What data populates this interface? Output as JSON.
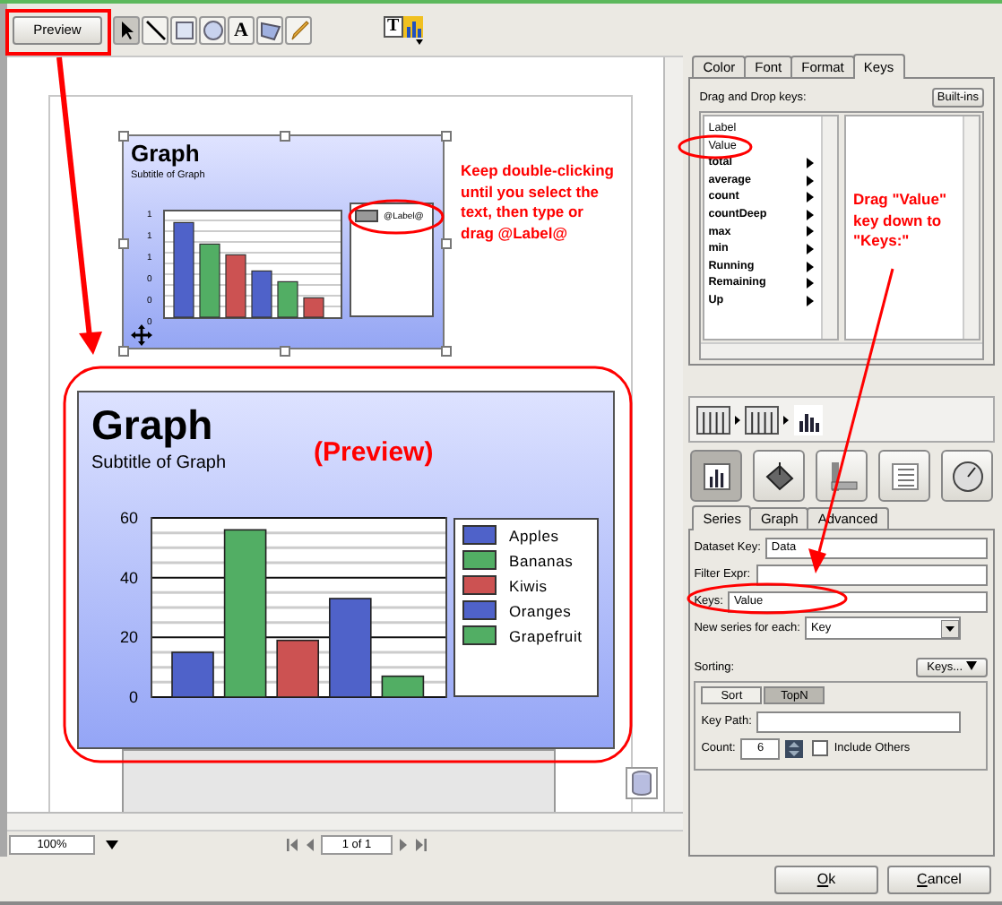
{
  "toolbar": {
    "preview_button": "Preview",
    "text_tool_glyph": "A",
    "chart_text_glyph": "T"
  },
  "designer_chart": {
    "title": "Graph",
    "subtitle": "Subtitle of Graph",
    "y_labels": [
      "1",
      "1",
      "1",
      "0",
      "0",
      "0"
    ],
    "legend_label": "@Label@"
  },
  "preview_chart": {
    "title": "Graph",
    "subtitle": "Subtitle of Graph",
    "chart_data": {
      "type": "bar",
      "ylim": [
        0,
        60
      ],
      "yticks": [
        0,
        20,
        40,
        60
      ],
      "series": [
        {
          "name": "Apples",
          "color": "#4f62c9",
          "values": [
            15
          ]
        },
        {
          "name": "Bananas",
          "color": "#52ae64",
          "values": [
            56
          ]
        },
        {
          "name": "Kiwis",
          "color": "#cc5252",
          "values": [
            19
          ]
        },
        {
          "name": "Oranges",
          "color": "#4f62c9",
          "values": [
            33
          ]
        },
        {
          "name": "Grapefruit",
          "color": "#52ae64",
          "values": [
            7
          ]
        }
      ]
    }
  },
  "annotations": [
    {
      "text": "Keep double-clicking until you select the text, then type or drag @Label@"
    },
    {
      "text": "(Preview)"
    },
    {
      "text": "Drag \"Value\" key down to \"Keys:\""
    }
  ],
  "bottom_bar": {
    "zoom": "100%",
    "page": "1 of 1"
  },
  "style_tabs": [
    {
      "label": "Color",
      "selected": false
    },
    {
      "label": "Font",
      "selected": false
    },
    {
      "label": "Format",
      "selected": false
    },
    {
      "label": "Keys",
      "selected": true
    }
  ],
  "keys_panel": {
    "label": "Drag and Drop keys:",
    "builtins_button": "Built-ins",
    "keys": [
      {
        "label": "Label",
        "has_submenu": false
      },
      {
        "label": "Value",
        "has_submenu": false
      },
      {
        "label": "total",
        "has_submenu": true
      },
      {
        "label": "average",
        "has_submenu": true
      },
      {
        "label": "count",
        "has_submenu": true
      },
      {
        "label": "countDeep",
        "has_submenu": true
      },
      {
        "label": "max",
        "has_submenu": true
      },
      {
        "label": "min",
        "has_submenu": true
      },
      {
        "label": "Running",
        "has_submenu": true
      },
      {
        "label": "Remaining",
        "has_submenu": true
      },
      {
        "label": "Up",
        "has_submenu": true
      }
    ]
  },
  "chart_type_buttons": [
    {
      "selected": true
    },
    {
      "selected": false
    },
    {
      "selected": false
    },
    {
      "selected": false
    },
    {
      "selected": false
    }
  ],
  "series_tabs": [
    {
      "label": "Series",
      "selected": true
    },
    {
      "label": "Graph",
      "selected": false
    },
    {
      "label": "Advanced",
      "selected": false
    }
  ],
  "series_form": {
    "dataset_key": {
      "label": "Dataset Key:",
      "value": "Data"
    },
    "filter_expr": {
      "label": "Filter Expr:"
    },
    "keys": {
      "label": "Keys:",
      "value": "Value"
    },
    "new_series": {
      "label": "New series for each:",
      "value": "Key"
    },
    "sorting": {
      "label": "Sorting:",
      "keys_button": "Keys..."
    },
    "sort_tabs": [
      {
        "label": "Sort",
        "selected": false
      },
      {
        "label": "TopN",
        "selected": true
      }
    ],
    "key_path": {
      "label": "Key Path:"
    },
    "count": {
      "label": "Count:",
      "value": "6"
    },
    "include_others": {
      "label": "Include Others",
      "checked": false
    }
  },
  "dialog_buttons": [
    {
      "label": "Ok"
    },
    {
      "label": "Cancel"
    }
  ]
}
